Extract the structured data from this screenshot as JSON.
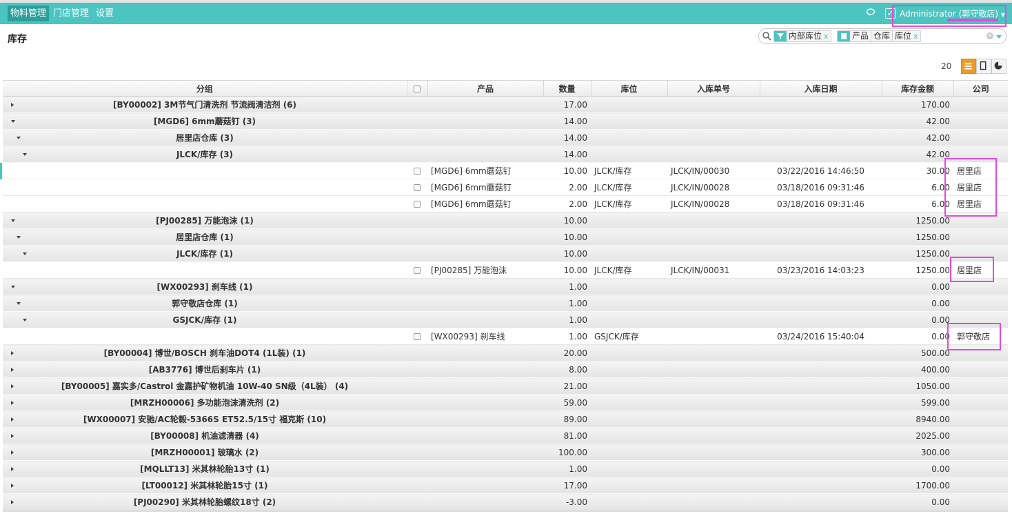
{
  "nav": {
    "menu": [
      "物料管理",
      "门店管理",
      "设置"
    ],
    "user": "Administrator (郭守敬店)"
  },
  "page": {
    "title": "库存"
  },
  "search": {
    "facets": [
      {
        "values": [
          "内部库位"
        ]
      },
      {
        "values": [
          "产品",
          "仓库",
          "库位"
        ]
      }
    ],
    "remove_glyph": "x"
  },
  "pager": {
    "count": "20"
  },
  "table": {
    "columns": [
      "分组",
      "产品",
      "数量",
      "库位",
      "入库单号",
      "入库日期",
      "库存金额",
      "公司"
    ],
    "rows": [
      {
        "type": "group",
        "level": 0,
        "expanded": false,
        "name": "[BY00002] 3M节气门清洗剂 节流阀清洁剂 (6)",
        "qty": "17.00",
        "amount": "170.00"
      },
      {
        "type": "group",
        "level": 0,
        "expanded": true,
        "name": "[MGD6] 6mm蘑菇钉 (3)",
        "qty": "14.00",
        "amount": "42.00"
      },
      {
        "type": "group",
        "level": 1,
        "expanded": true,
        "name": "居里店仓库 (3)",
        "qty": "14.00",
        "amount": "42.00"
      },
      {
        "type": "group",
        "level": 2,
        "expanded": true,
        "name": "JLCK/库存 (3)",
        "qty": "14.00",
        "amount": "42.00"
      },
      {
        "type": "record",
        "product": "[MGD6] 6mm蘑菇钉",
        "qty": "10.00",
        "location": "JLCK/库存",
        "ref": "JLCK/IN/00030",
        "date": "03/22/2016 14:46:50",
        "amount": "30.00",
        "company": "居里店"
      },
      {
        "type": "record",
        "product": "[MGD6] 6mm蘑菇钉",
        "qty": "2.00",
        "location": "JLCK/库存",
        "ref": "JLCK/IN/00028",
        "date": "03/18/2016 09:31:46",
        "amount": "6.00",
        "company": "居里店"
      },
      {
        "type": "record",
        "product": "[MGD6] 6mm蘑菇钉",
        "qty": "2.00",
        "location": "JLCK/库存",
        "ref": "JLCK/IN/00028",
        "date": "03/18/2016 09:31:46",
        "amount": "6.00",
        "company": "居里店"
      },
      {
        "type": "group",
        "level": 0,
        "expanded": true,
        "name": "[PJ00285] 万能泡沫 (1)",
        "qty": "10.00",
        "amount": "1250.00"
      },
      {
        "type": "group",
        "level": 1,
        "expanded": true,
        "name": "居里店仓库 (1)",
        "qty": "10.00",
        "amount": "1250.00"
      },
      {
        "type": "group",
        "level": 2,
        "expanded": true,
        "name": "JLCK/库存 (1)",
        "qty": "10.00",
        "amount": "1250.00"
      },
      {
        "type": "record",
        "product": "[PJ00285] 万能泡沫",
        "qty": "10.00",
        "location": "JLCK/库存",
        "ref": "JLCK/IN/00031",
        "date": "03/23/2016 14:03:23",
        "amount": "1250.00",
        "company": "居里店"
      },
      {
        "type": "group",
        "level": 0,
        "expanded": true,
        "name": "[WX00293] 刹车线 (1)",
        "qty": "1.00",
        "amount": "0.00"
      },
      {
        "type": "group",
        "level": 1,
        "expanded": true,
        "name": "郭守敬店仓库 (1)",
        "qty": "1.00",
        "amount": "0.00"
      },
      {
        "type": "group",
        "level": 2,
        "expanded": true,
        "name": "GSJCK/库存 (1)",
        "qty": "1.00",
        "amount": "0.00"
      },
      {
        "type": "record",
        "product": "[WX00293] 刹车线",
        "qty": "1.00",
        "location": "GSJCK/库存",
        "ref": "",
        "date": "03/24/2016 15:40:04",
        "amount": "0.00",
        "company": "郭守敬店"
      },
      {
        "type": "group",
        "level": 0,
        "expanded": false,
        "name": "[BY00004] 博世/BOSCH 刹车油DOT4 (1L装) (1)",
        "qty": "20.00",
        "amount": "500.00"
      },
      {
        "type": "group",
        "level": 0,
        "expanded": false,
        "name": "[AB3776] 博世后刹车片 (1)",
        "qty": "8.00",
        "amount": "400.00"
      },
      {
        "type": "group",
        "level": 0,
        "expanded": false,
        "name": "[BY00005] 嘉实多/Castrol 金嘉护矿物机油 10W-40 SN级（4L装） (4)",
        "qty": "21.00",
        "amount": "1050.00"
      },
      {
        "type": "group",
        "level": 0,
        "expanded": false,
        "name": "[MRZH00006] 多功能泡沫清洗剂 (2)",
        "qty": "59.00",
        "amount": "599.00"
      },
      {
        "type": "group",
        "level": 0,
        "expanded": false,
        "name": "[WX00007] 安驰/AC轮毂-5366S ET52.5/15寸 福克斯 (10)",
        "qty": "89.00",
        "amount": "8940.00"
      },
      {
        "type": "group",
        "level": 0,
        "expanded": false,
        "name": "[BY00008] 机油滤清器 (4)",
        "qty": "81.00",
        "amount": "2025.00"
      },
      {
        "type": "group",
        "level": 0,
        "expanded": false,
        "name": "[MRZH00001] 玻璃水 (2)",
        "qty": "100.00",
        "amount": "300.00"
      },
      {
        "type": "group",
        "level": 0,
        "expanded": false,
        "name": "[MQLLT13] 米其林轮胎13寸 (1)",
        "qty": "1.00",
        "amount": "0.00"
      },
      {
        "type": "group",
        "level": 0,
        "expanded": false,
        "name": "[LT00012] 米其林轮胎15寸 (1)",
        "qty": "17.00",
        "amount": "1700.00"
      },
      {
        "type": "group",
        "level": 0,
        "expanded": false,
        "name": "[PJ00290] 米其林轮胎螺纹18寸 (2)",
        "qty": "-3.00",
        "amount": "0.00"
      }
    ]
  },
  "colors": {
    "brand": "#4cc4c0",
    "highlight": "#e04be0",
    "active_view": "#ed9c28"
  }
}
